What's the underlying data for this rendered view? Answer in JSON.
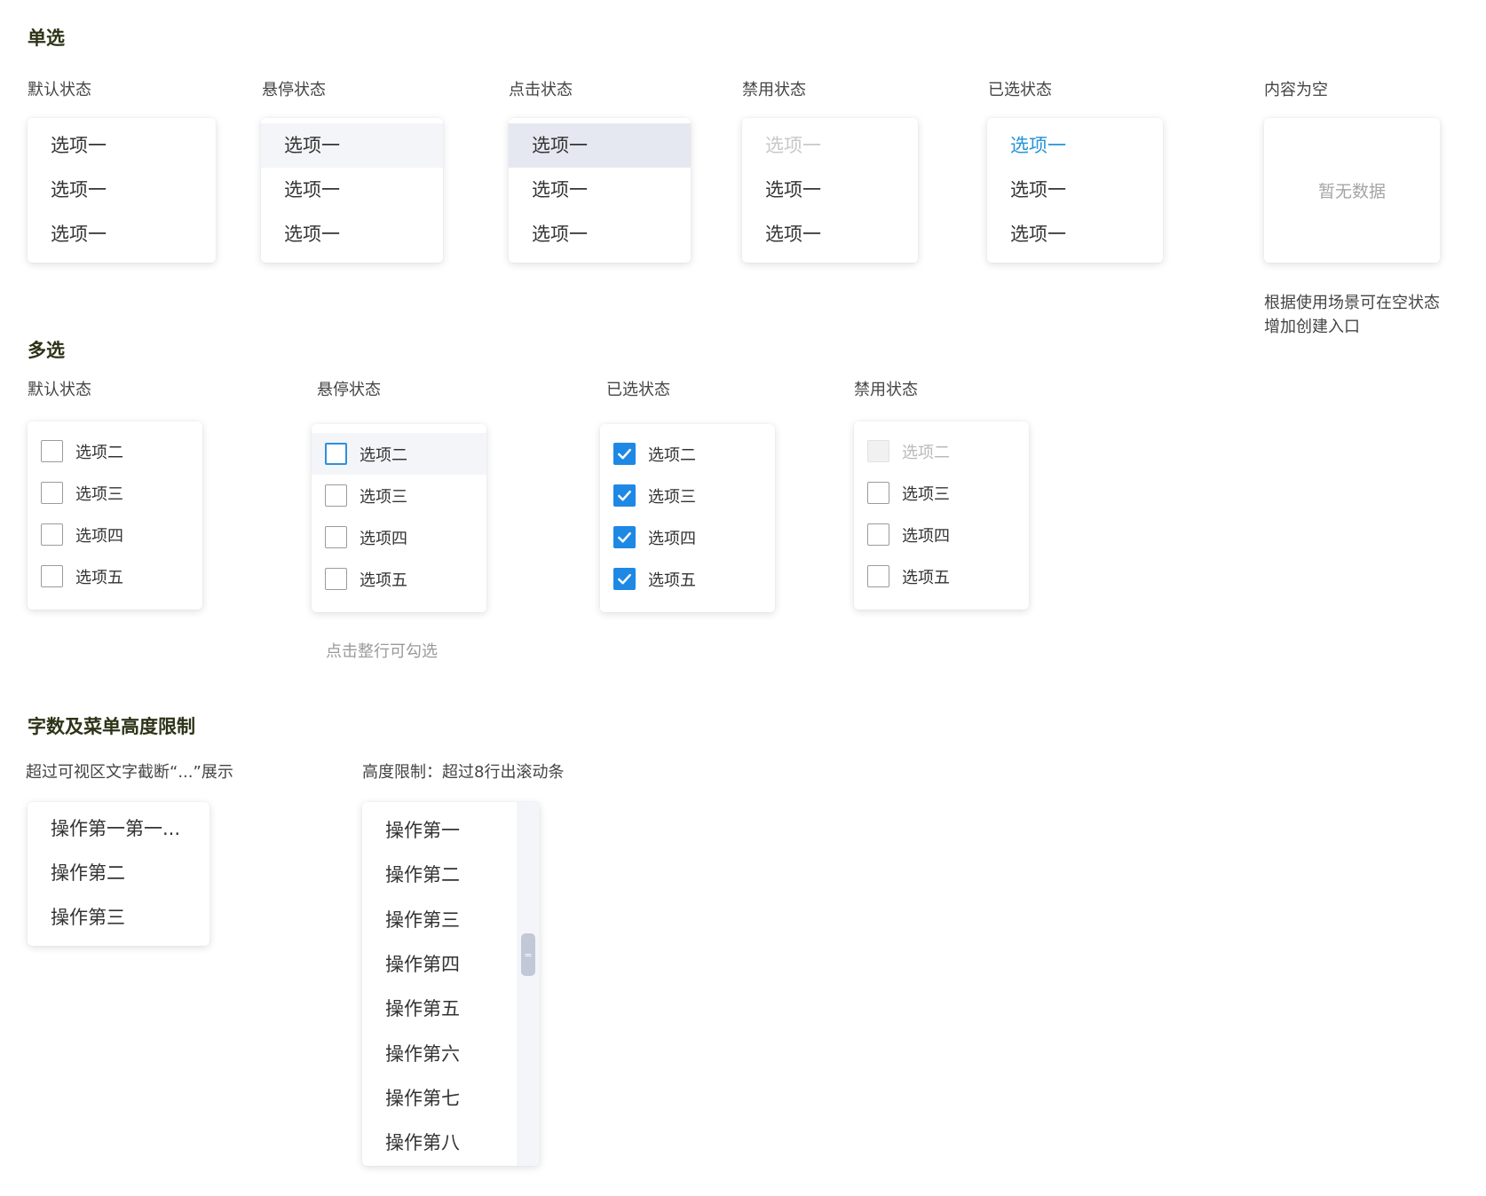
{
  "single": {
    "title": "单选",
    "default": {
      "label": "默认状态",
      "items": [
        "选项一",
        "选项一",
        "选项一"
      ]
    },
    "hover": {
      "label": "悬停状态",
      "items": [
        "选项一",
        "选项一",
        "选项一"
      ]
    },
    "click": {
      "label": "点击状态",
      "items": [
        "选项一",
        "选项一",
        "选项一"
      ]
    },
    "disabled": {
      "label": "禁用状态",
      "items": [
        "选项一",
        "选项一",
        "选项一"
      ]
    },
    "selected": {
      "label": "已选状态",
      "items": [
        "选项一",
        "选项一",
        "选项一"
      ]
    },
    "empty": {
      "label": "内容为空",
      "text": "暂无数据",
      "note_line1": "根据使用场景可在空状态",
      "note_line2": "增加创建入口"
    },
    "colors": {
      "selected_text": "#2693d9",
      "hover_bg": "#f4f5f8",
      "active_bg": "#e5e8f1"
    }
  },
  "multi": {
    "title": "多选",
    "default": {
      "label": "默认状态",
      "items": [
        "选项二",
        "选项三",
        "选项四",
        "选项五"
      ],
      "checked": [
        false,
        false,
        false,
        false
      ]
    },
    "hover": {
      "label": "悬停状态",
      "items": [
        "选项二",
        "选项三",
        "选项四",
        "选项五"
      ],
      "checked": [
        false,
        false,
        false,
        false
      ],
      "hint": "点击整行可勾选"
    },
    "selected": {
      "label": "已选状态",
      "items": [
        "选项二",
        "选项三",
        "选项四",
        "选项五"
      ],
      "checked": [
        true,
        true,
        true,
        true
      ]
    },
    "disabled": {
      "label": "禁用状态",
      "items": [
        "选项二",
        "选项三",
        "选项四",
        "选项五"
      ],
      "checked": [
        false,
        false,
        false,
        false
      ]
    },
    "colors": {
      "checked_fill": "#1e88e5"
    },
    "check_icon": "checkmark-icon"
  },
  "limits": {
    "title": "字数及菜单高度限制",
    "truncate": {
      "label": "超过可视区文字截断“...”展示",
      "items": [
        "操作第一第一...",
        "操作第二",
        "操作第三"
      ]
    },
    "height": {
      "label": "高度限制：超过8行出滚动条",
      "items": [
        "操作第一",
        "操作第二",
        "操作第三",
        "操作第四",
        "操作第五",
        "操作第六",
        "操作第七",
        "操作第八"
      ],
      "thumb_glyph": "="
    }
  }
}
